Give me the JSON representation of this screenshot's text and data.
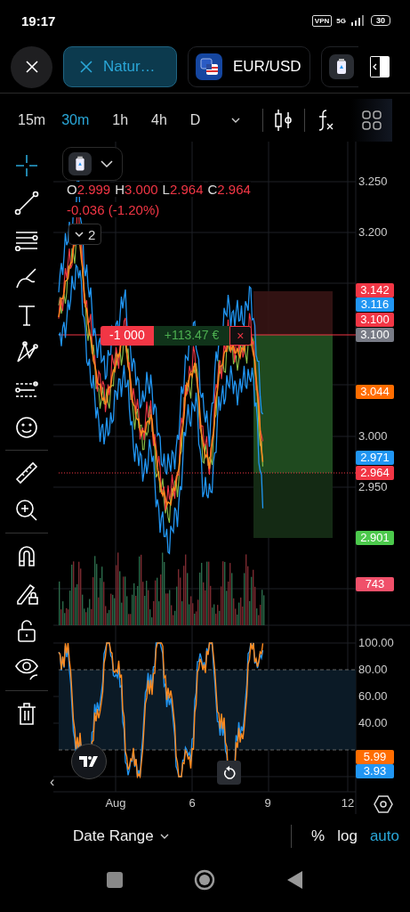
{
  "status_bar": {
    "time": "19:17",
    "vpn": "VPN",
    "network": "5G",
    "battery": "30"
  },
  "symbol_tabs": [
    {
      "kind": "closable",
      "label": "Natur…",
      "selected": true
    },
    {
      "kind": "flag",
      "label": "EUR/USD",
      "selected": false
    },
    {
      "kind": "icon",
      "selected": false
    }
  ],
  "timeframes": [
    {
      "label": "15m",
      "selected": false
    },
    {
      "label": "30m",
      "selected": true
    },
    {
      "label": "1h",
      "selected": false
    },
    {
      "label": "4h",
      "selected": false
    },
    {
      "label": "D",
      "selected": false
    }
  ],
  "tools": [
    {
      "kind": "crosshair",
      "selected": true
    },
    {
      "kind": "line",
      "selected": false
    },
    {
      "kind": "fib",
      "selected": false
    },
    {
      "kind": "brush",
      "selected": false
    },
    {
      "kind": "text",
      "selected": false
    },
    {
      "kind": "pattern",
      "selected": false
    },
    {
      "kind": "projection",
      "selected": false
    },
    {
      "kind": "smiley",
      "selected": false
    },
    {
      "kind": "divider"
    },
    {
      "kind": "ruler",
      "selected": false
    },
    {
      "kind": "zoom",
      "selected": false
    },
    {
      "kind": "divider"
    },
    {
      "kind": "magnet",
      "selected": false
    },
    {
      "kind": "lockdraw",
      "selected": false
    },
    {
      "kind": "lock",
      "selected": false
    },
    {
      "kind": "eye",
      "selected": false
    },
    {
      "kind": "divider"
    },
    {
      "kind": "trash",
      "selected": false
    }
  ],
  "legend": {
    "values": [
      {
        "label": "O",
        "value": "2.999"
      },
      {
        "label": "H",
        "value": "3.000"
      },
      {
        "label": "L",
        "value": "2.964"
      },
      {
        "label": "C",
        "value": "2.964"
      }
    ],
    "change": "-0.036 (-1.20%)"
  },
  "indicator_toggle": {
    "count": "2"
  },
  "position": {
    "quantity": "-1 000",
    "pnl": "+113.47 €",
    "close": "×"
  },
  "price_axis": {
    "ticks": [
      "3.250",
      "3.200",
      "3.000",
      "2.950"
    ],
    "tags": [
      {
        "text": "3.142",
        "color": "#f23645"
      },
      {
        "text": "3.116",
        "color": "#2196f3"
      },
      {
        "text": "3.100",
        "color": "#f23645"
      },
      {
        "text": "3.100",
        "color": "#787b86"
      },
      {
        "text": "3.044",
        "color": "#ff6d00"
      },
      {
        "text": "2.971",
        "color": "#2196f3"
      },
      {
        "text": "2.964",
        "color": "#f23645"
      },
      {
        "text": "2.901",
        "color": "#4cc94c"
      },
      {
        "text": "743",
        "color": "#f0506a"
      }
    ]
  },
  "oscillator_axis": {
    "ticks": [
      "100.00",
      "80.00",
      "60.00",
      "40.00"
    ],
    "tags": [
      {
        "text": "5.99",
        "color": "#ff6d00"
      },
      {
        "text": "3.93",
        "color": "#2196f3"
      }
    ]
  },
  "time_axis": [
    "Aug",
    "6",
    "9",
    "12"
  ],
  "collapse": "‹",
  "bottom_bar": {
    "date_range": "Date Range",
    "options": [
      {
        "label": "%",
        "selected": false
      },
      {
        "label": "log",
        "selected": false
      },
      {
        "label": "auto",
        "selected": true
      }
    ]
  }
}
